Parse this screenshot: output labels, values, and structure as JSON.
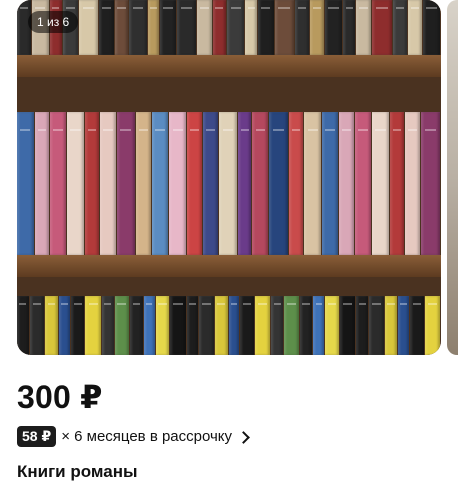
{
  "gallery": {
    "counter": "1 из 6",
    "image_alt": "Книжная полка с книгами",
    "accent_colors": [
      "#6b4a2e",
      "#4a3220",
      "#b52a2a",
      "#2a4f8f",
      "#1d1d1d",
      "#d9c73a"
    ]
  },
  "listing": {
    "price": "300 ₽",
    "installment": {
      "amount": "58 ₽",
      "text": "× 6 месяцев в рассрочку"
    },
    "title": "Книги романы"
  },
  "icons": {
    "installment_arrow": "chevron-right-icon"
  }
}
